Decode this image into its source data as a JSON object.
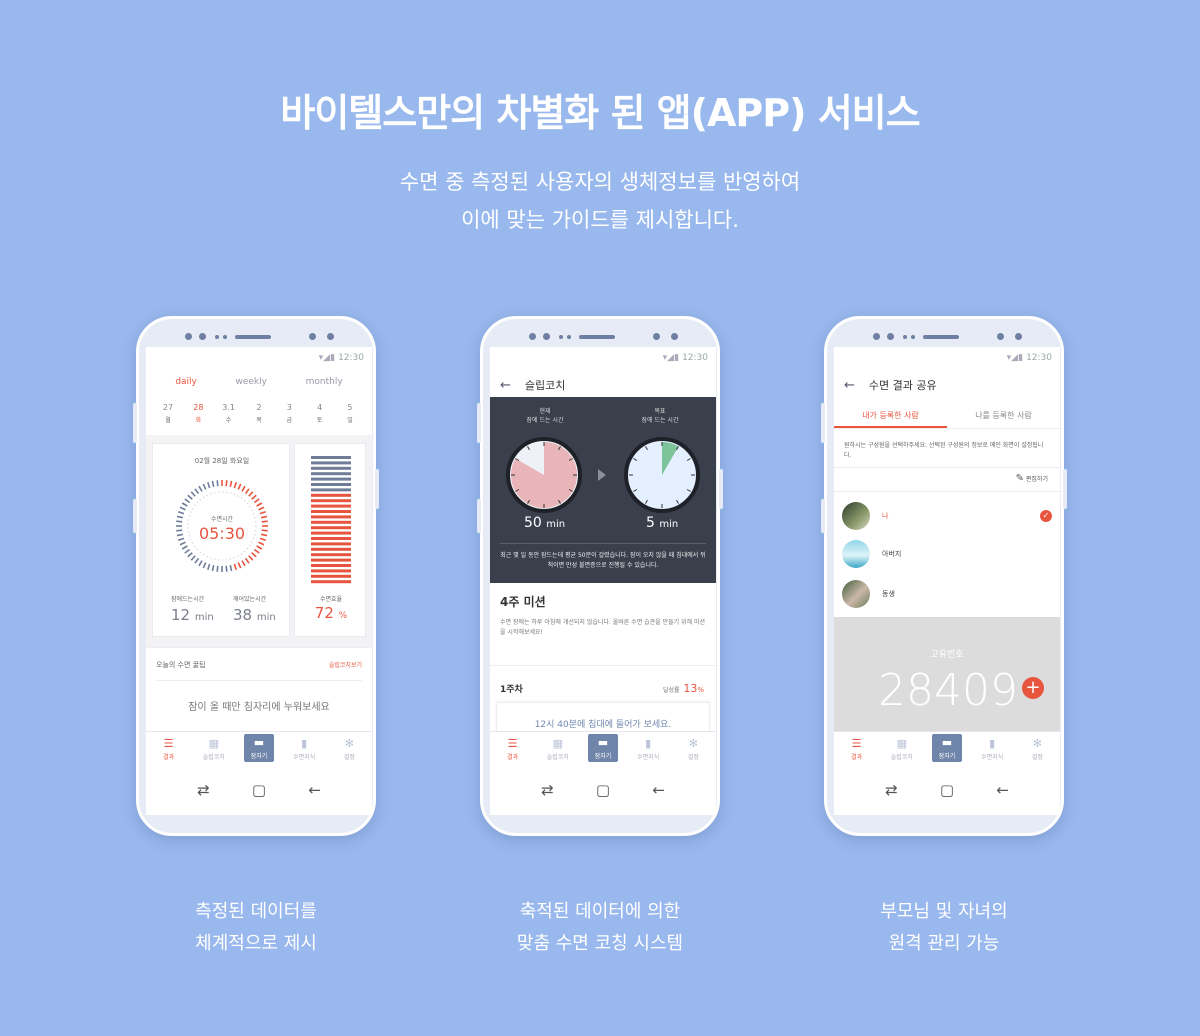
{
  "header": {
    "title": "바이텔스만의 차별화 된 앱(APP) 서비스",
    "subtitle_line1": "수면 중 측정된 사용자의 생체정보를 반영하여",
    "subtitle_line2": "이에 맞는 가이드를 제시합니다."
  },
  "status_bar": {
    "time": "12:30"
  },
  "bottom_nav": {
    "items": [
      {
        "label": "결과",
        "icon": "bar-chart-icon"
      },
      {
        "label": "슬립코치",
        "icon": "calendar-icon"
      },
      {
        "label": "잠자기",
        "icon": "bed-icon"
      },
      {
        "label": "수면지식",
        "icon": "book-icon"
      },
      {
        "label": "설정",
        "icon": "gear-icon"
      }
    ]
  },
  "phone1": {
    "tabs": [
      "daily",
      "weekly",
      "monthly"
    ],
    "dates": [
      {
        "d": "27",
        "w": "월"
      },
      {
        "d": "28",
        "w": "화"
      },
      {
        "d": "3.1",
        "w": "수"
      },
      {
        "d": "2",
        "w": "목"
      },
      {
        "d": "3",
        "w": "금"
      },
      {
        "d": "4",
        "w": "토"
      },
      {
        "d": "5",
        "w": "일"
      }
    ],
    "date_label": "02월 28일 화요일",
    "sleep_time_label": "수면시간",
    "sleep_time": "05:30",
    "fall_asleep_label": "잠에드는시간",
    "fall_asleep_value": "12",
    "awake_label": "깨어있는시간",
    "awake_value": "38",
    "unit_min": "min",
    "efficiency_label": "수면효율",
    "efficiency_value": "72",
    "efficiency_unit": "%",
    "tip_label": "오늘의 수면 꿀팁",
    "tip_link": "슬립코치보기",
    "tip_text": "잠이 올 때만 침자리에 누워보세요"
  },
  "phone2": {
    "title": "슬립코치",
    "current_label": "현재",
    "current_sub": "잠에 드는 시간",
    "current_value": "50",
    "target_label": "목표",
    "target_sub": "잠에 드는 시간",
    "target_value": "5",
    "unit_min": "min",
    "note": "최근 몇 일 동안 잠드는데 평균 50분이 걸렸습니다. 잠이 오지 않을 때 침대에서 뒤척이면 만성 불면증으로 진행될 수 있습니다.",
    "mission_title": "4주 미션",
    "mission_desc": "수면 장애는 하루 아침에 개선되지 않습니다. 올바른 수면 습관을 만들기 위해 미션을 시작해보세요!",
    "week_label": "1주차",
    "achieve_label": "달성률",
    "achieve_value": "13",
    "achieve_unit": "%",
    "week_task": "12시 40분에 침대에 들어가 보세요."
  },
  "phone3": {
    "title": "수면 결과 공유",
    "tab_mine": "내가 등록한 사람",
    "tab_others": "나를 등록한 사람",
    "desc": "원하시는 구성원을 선택하주세요. 선택된 구성원의 정보로 메인 화면이 설정됩니다.",
    "edit_label": "편집하기",
    "members": [
      "나",
      "아버지",
      "동생"
    ],
    "uid_label": "고유번호",
    "uid_value": "28409"
  },
  "captions": {
    "c1_line1": "측정된 데이터를",
    "c1_line2": "체계적으로 제시",
    "c2_line1": "축적된 데이터에 의한",
    "c2_line2": "맞춤 수면 코칭 시스템",
    "c3_line1": "부모님 및 자녀의",
    "c3_line2": "원격 관리 가능"
  },
  "colors": {
    "background": "#99b8ed",
    "accent": "#e8553f",
    "dark_panel": "#3a3f4c"
  }
}
